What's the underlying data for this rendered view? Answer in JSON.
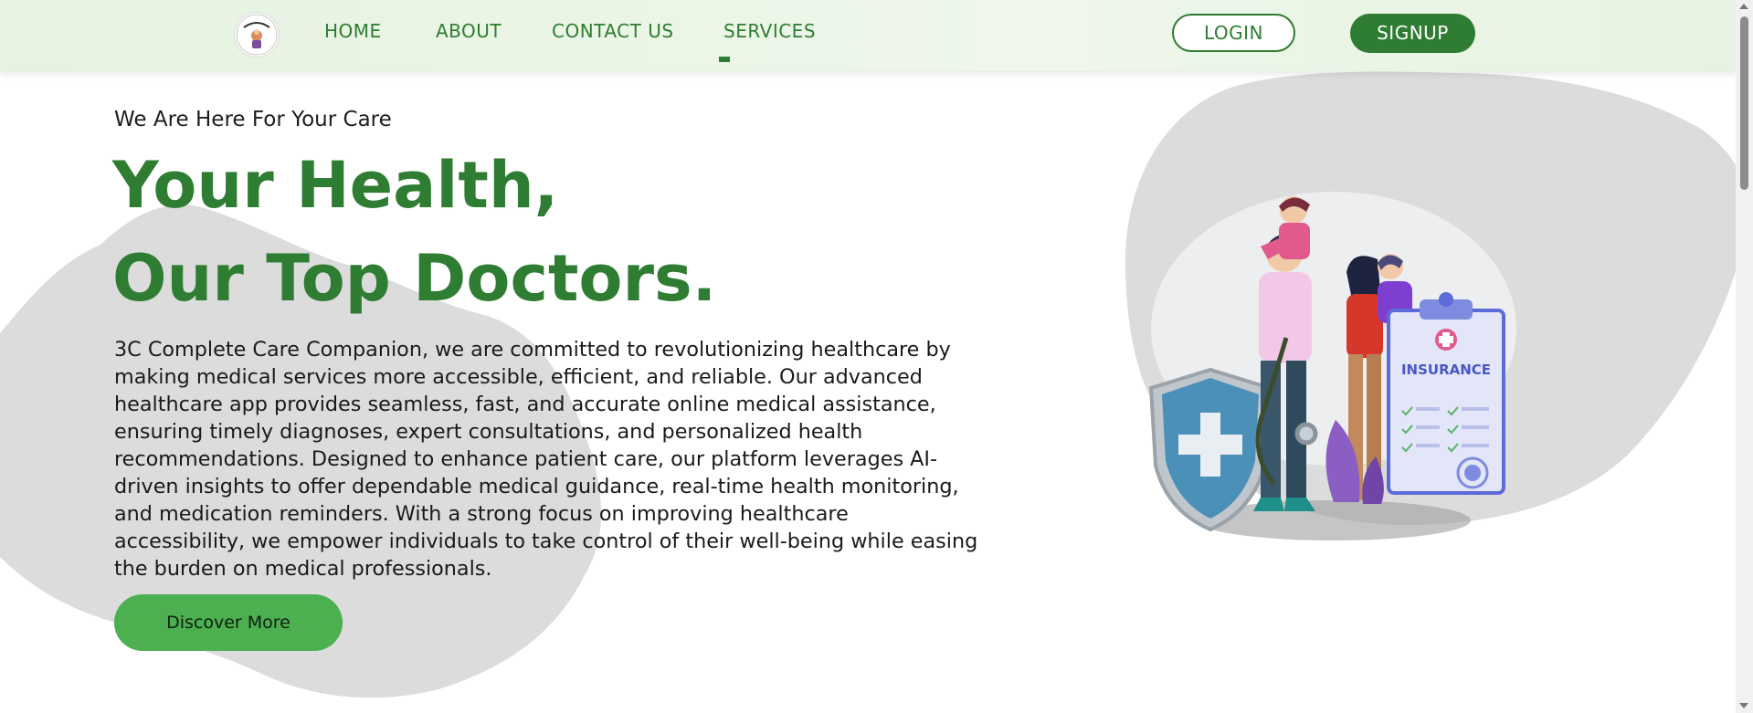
{
  "nav": {
    "links": [
      "HOME",
      "ABOUT",
      "CONTACT US",
      "SERVICES"
    ],
    "active": "SERVICES",
    "login_label": "LOGIN",
    "signup_label": "SIGNUP"
  },
  "hero": {
    "eyebrow": "We Are Here For Your Care",
    "headline_line1": "Your Health,",
    "headline_line2": "Our Top Doctors.",
    "description": "3C Complete Care Companion, we are committed to revolutionizing healthcare by making medical services more accessible, efficient, and reliable. Our advanced healthcare app provides seamless, fast, and accurate online medical assistance, ensuring timely diagnoses, expert consultations, and personalized health recommendations. Designed to enhance patient care, our platform leverages AI-driven insights to offer dependable medical guidance, real-time health monitoring, and medication reminders. With a strong focus on improving healthcare accessibility, we empower individuals to take control of their well-being while easing the burden on medical professionals.",
    "cta_label": "Discover More"
  },
  "illustration": {
    "clipboard_title": "INSURANCE"
  },
  "colors": {
    "brand_green": "#2e7d32",
    "cta_green": "#4caf50",
    "blob_gray": "#dcdcdc",
    "nav_bg": "#e8f4e3"
  },
  "icons": {
    "logo": "3c-logo-icon",
    "shield": "medical-shield-icon"
  }
}
